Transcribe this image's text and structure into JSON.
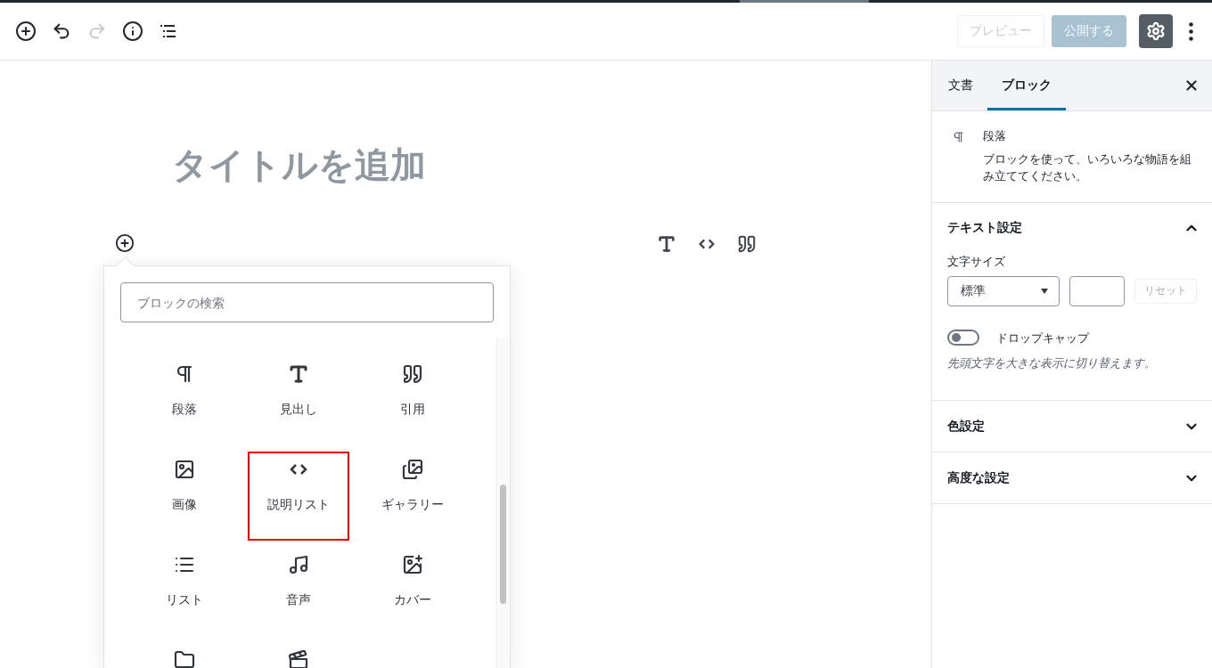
{
  "toolbar": {
    "tools": [
      {
        "kind": "add",
        "disabled": false
      },
      {
        "kind": "undo",
        "disabled": false
      },
      {
        "kind": "redo",
        "disabled": true
      },
      {
        "kind": "info",
        "disabled": false
      },
      {
        "kind": "outline",
        "disabled": false
      }
    ],
    "preview_button": {
      "label": "プレビュー",
      "disabled": true
    },
    "publish_button": {
      "label": "公開する",
      "disabled": true
    },
    "settings_button": {
      "active": true
    }
  },
  "editor": {
    "title_placeholder": "タイトルを追加",
    "inline_tools": [
      {
        "kind": "heading"
      },
      {
        "kind": "code"
      },
      {
        "kind": "quote"
      }
    ],
    "inserter": {
      "search": {
        "placeholder": "ブロックの検索"
      },
      "blocks": [
        {
          "kind": "paragraph",
          "label": "段落",
          "highlighted": false
        },
        {
          "kind": "heading",
          "label": "見出し",
          "highlighted": false
        },
        {
          "kind": "quote",
          "label": "引用",
          "highlighted": false
        },
        {
          "kind": "image",
          "label": "画像",
          "highlighted": false
        },
        {
          "kind": "code",
          "label": "説明リスト",
          "highlighted": true
        },
        {
          "kind": "gallery",
          "label": "ギャラリー",
          "highlighted": false
        },
        {
          "kind": "list",
          "label": "リスト",
          "highlighted": false
        },
        {
          "kind": "audio",
          "label": "音声",
          "highlighted": false
        },
        {
          "kind": "cover",
          "label": "カバー",
          "highlighted": false
        },
        {
          "kind": "file",
          "highlighted": false
        },
        {
          "kind": "video",
          "highlighted": false
        }
      ]
    }
  },
  "sidebar": {
    "tabs": [
      {
        "label": "文書",
        "selected": false
      },
      {
        "label": "ブロック",
        "selected": true
      }
    ],
    "block_card": {
      "title": "段落",
      "description": "ブロックを使って、いろいろな物語を組み立ててください。"
    },
    "panels": [
      {
        "title": "テキスト設定",
        "expanded": true,
        "font_size_label": "文字サイズ",
        "font_size_select": "標準",
        "reset_button": {
          "label": "リセット",
          "disabled": true
        },
        "drop_cap": {
          "label": "ドロップキャップ",
          "on": false,
          "help": "先頭文字を大きな表示に切り替えます。"
        }
      },
      {
        "title": "色設定",
        "expanded": false
      },
      {
        "title": "高度な設定",
        "expanded": false
      }
    ]
  }
}
